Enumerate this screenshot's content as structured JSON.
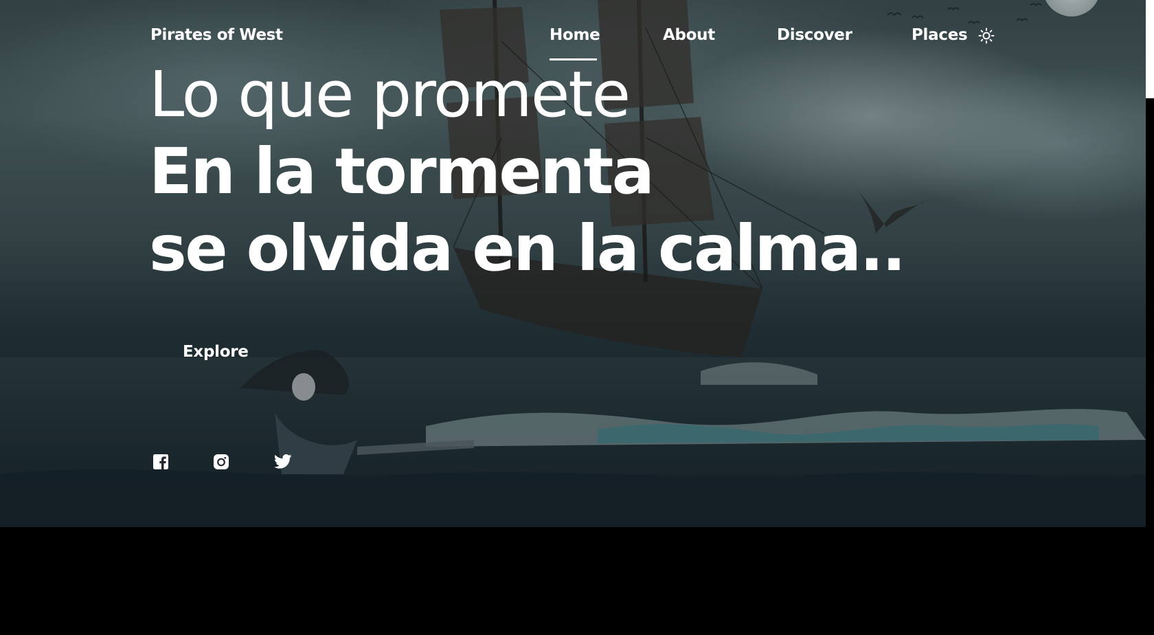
{
  "brand": {
    "name": "Pirates of West"
  },
  "nav": {
    "items": [
      {
        "label": "Home",
        "active": true
      },
      {
        "label": "About",
        "active": false
      },
      {
        "label": "Discover",
        "active": false
      },
      {
        "label": "Places",
        "active": false
      }
    ],
    "theme_toggle_icon": "sun-icon"
  },
  "hero": {
    "headline": {
      "line1": "Lo que promete",
      "line2": "En la tormenta",
      "line3": "se olvida en la calma.."
    },
    "cta_label": "Explore",
    "background": "stormy-sea-pirate-ship-image"
  },
  "social": {
    "icons": [
      "facebook-icon",
      "instagram-icon",
      "twitter-icon"
    ]
  },
  "colors": {
    "text": "#ffffff",
    "page_background": "#000000",
    "scrollbar_thumb": "#ffffff"
  }
}
